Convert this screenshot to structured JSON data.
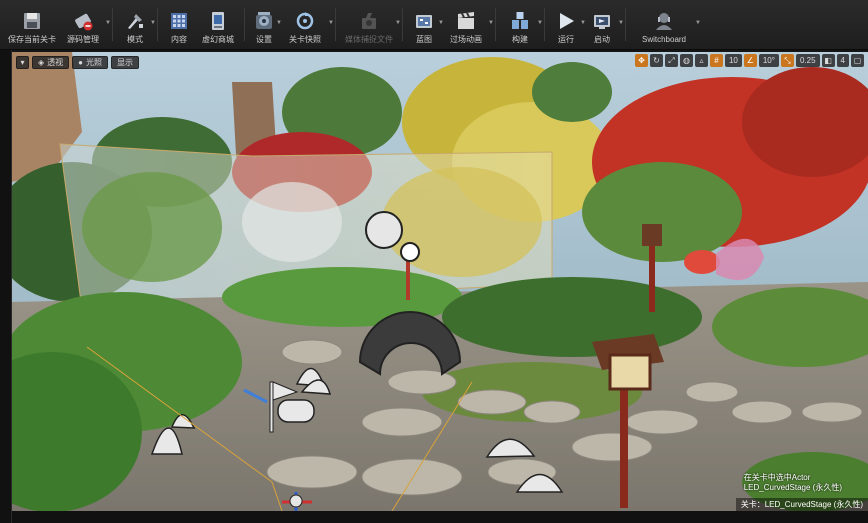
{
  "toolbar": {
    "items": [
      {
        "label": "保存当前关卡",
        "icon": "save-icon"
      },
      {
        "label": "源码管理",
        "icon": "source-control-icon"
      },
      {
        "label": "模式",
        "icon": "modes-icon"
      },
      {
        "label": "内容",
        "icon": "content-icon"
      },
      {
        "label": "虚幻商城",
        "icon": "marketplace-icon"
      },
      {
        "label": "设置",
        "icon": "settings-icon"
      },
      {
        "label": "关卡快照",
        "icon": "level-snapshot-icon"
      },
      {
        "label": "媒体捕捉文件",
        "icon": "media-capture-icon"
      },
      {
        "label": "蓝图",
        "icon": "blueprint-icon"
      },
      {
        "label": "过场动画",
        "icon": "cinematics-icon"
      },
      {
        "label": "构建",
        "icon": "build-icon"
      },
      {
        "label": "运行",
        "icon": "play-icon"
      },
      {
        "label": "启动",
        "icon": "launch-icon"
      },
      {
        "label": "Switchboard",
        "icon": "switchboard-icon"
      }
    ]
  },
  "viewport": {
    "perspective_label": "透视",
    "lit_label": "光照",
    "show_label": "显示",
    "grid_snap_value": "10",
    "rotation_snap_value": "10°",
    "scale_snap_value": "0.25",
    "camera_speed_value": "4"
  },
  "status": {
    "line1": "在关卡中选中Actor",
    "line2": "LED_CurvedStage (永久性)",
    "level_label": "关卡：LED_CurvedStage (永久性)"
  },
  "colors": {
    "toolbar_bg": "#242424",
    "accent": "#c9761f",
    "sky": "#9fbccc"
  }
}
